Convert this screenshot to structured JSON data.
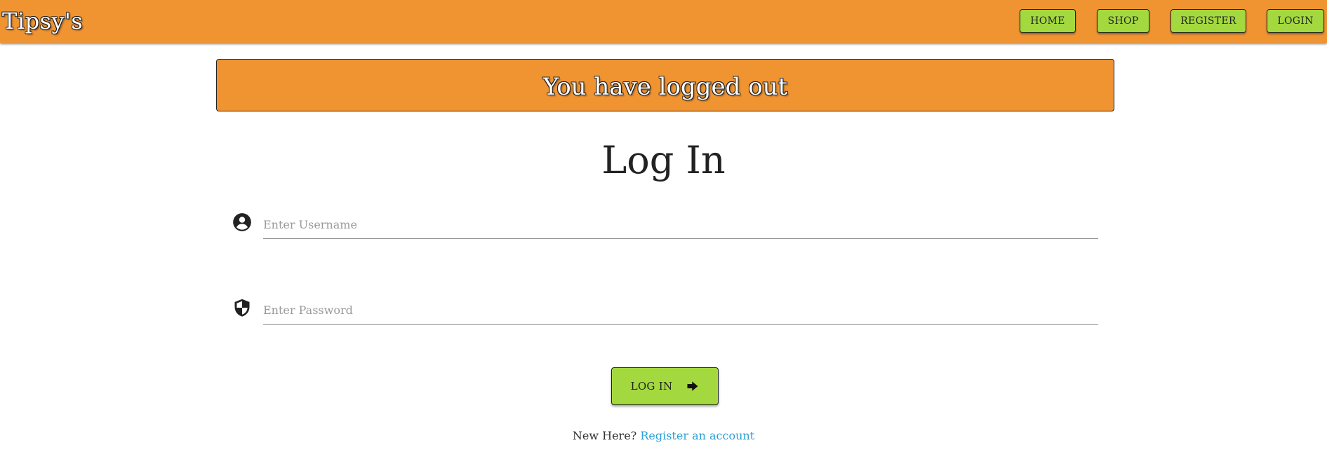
{
  "navbar": {
    "brand": "Tipsy's",
    "links": {
      "home": "HOME",
      "shop": "SHOP",
      "register": "REGISTER",
      "login": "LOGIN"
    }
  },
  "alert": {
    "message": "You have logged out"
  },
  "form": {
    "title": "Log In",
    "username": {
      "placeholder": "Enter Username",
      "value": "",
      "icon": "user-circle-icon"
    },
    "password": {
      "placeholder": "Enter Password",
      "value": "",
      "icon": "shield-icon"
    },
    "submit_label": "LOG IN",
    "submit_icon": "arrow-right-icon"
  },
  "footer": {
    "prompt": "New Here?",
    "link_text": "Register an account"
  },
  "colors": {
    "navbar_bg": "#f09432",
    "button_bg": "#a3d93e",
    "link": "#2a9fd6"
  }
}
